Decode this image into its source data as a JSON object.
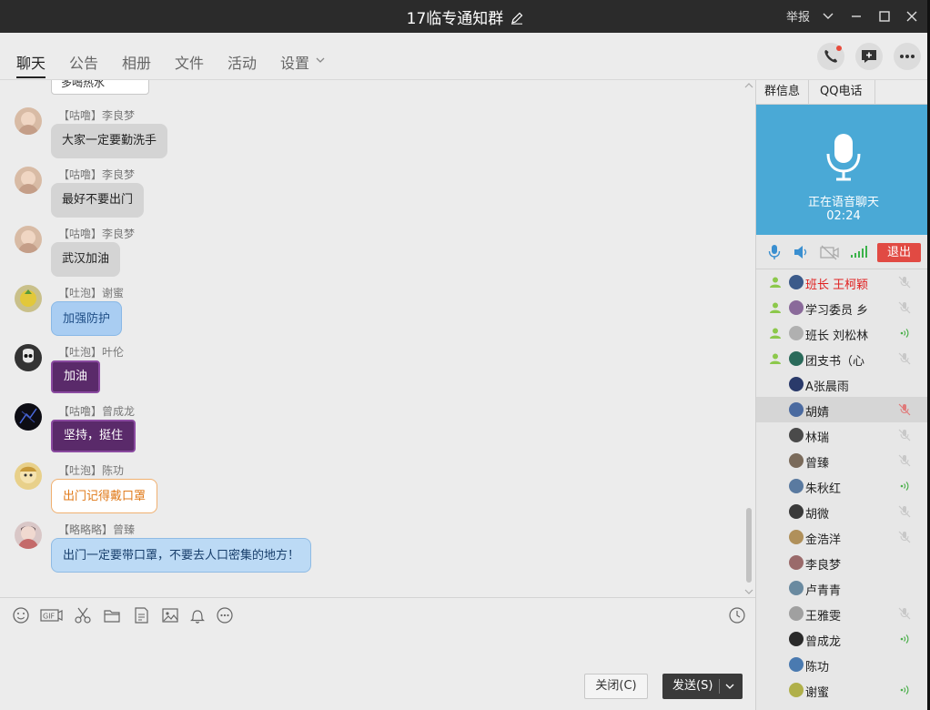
{
  "titlebar": {
    "title": "17临专通知群",
    "report": "举报"
  },
  "tabs": [
    {
      "label": "聊天"
    },
    {
      "label": "公告"
    },
    {
      "label": "相册"
    },
    {
      "label": "文件"
    },
    {
      "label": "活动"
    },
    {
      "label": "设置"
    }
  ],
  "messages": [
    {
      "header": "【咕噜】李良梦",
      "text": "大家一定要勤洗手"
    },
    {
      "header": "【咕噜】李良梦",
      "text": "最好不要出门"
    },
    {
      "header": "【咕噜】李良梦",
      "text": "武汉加油"
    },
    {
      "header": "【吐泡】谢蜜",
      "text": "加强防护"
    },
    {
      "header": "【吐泡】叶伦",
      "text": "加油"
    },
    {
      "header": "【咕噜】曾成龙",
      "text": "坚持，挺住"
    },
    {
      "header": "【吐泡】陈功",
      "text": "出门记得戴口罩"
    },
    {
      "header": "【略略略】曾臻",
      "text": "出门一定要带口罩，不要去人口密集的地方！"
    }
  ],
  "partial_top_message": "多喝热水",
  "input": {
    "close_label": "关闭(C)",
    "send_label": "发送(S)"
  },
  "side": {
    "tabs": [
      {
        "label": "群信息"
      },
      {
        "label": "QQ电话"
      }
    ],
    "voice_status": "正在语音聊天",
    "voice_time": "02:24",
    "quit_label": "退出",
    "members": [
      {
        "name": "班长 王柯颖",
        "admin": true,
        "red": true,
        "mic": "muted"
      },
      {
        "name": "学习委员 乡",
        "admin": true,
        "red": false,
        "mic": "muted"
      },
      {
        "name": "班长 刘松林",
        "admin": true,
        "red": false,
        "mic": "speaking"
      },
      {
        "name": "团支书（心",
        "admin": true,
        "red": false,
        "mic": "muted"
      },
      {
        "name": "A张晨雨",
        "admin": false,
        "red": false,
        "mic": "none"
      },
      {
        "name": "胡婧",
        "admin": false,
        "red": false,
        "mic": "muted-red",
        "selected": true
      },
      {
        "name": "林瑞",
        "admin": false,
        "red": false,
        "mic": "muted"
      },
      {
        "name": "曾臻",
        "admin": false,
        "red": false,
        "mic": "muted"
      },
      {
        "name": "朱秋红",
        "admin": false,
        "red": false,
        "mic": "speaking"
      },
      {
        "name": "胡微",
        "admin": false,
        "red": false,
        "mic": "muted"
      },
      {
        "name": "金浩洋",
        "admin": false,
        "red": false,
        "mic": "muted"
      },
      {
        "name": "李良梦",
        "admin": false,
        "red": false,
        "mic": "none"
      },
      {
        "name": "卢青青",
        "admin": false,
        "red": false,
        "mic": "none"
      },
      {
        "name": "王雅雯",
        "admin": false,
        "red": false,
        "mic": "muted"
      },
      {
        "name": "曾成龙",
        "admin": false,
        "red": false,
        "mic": "speaking"
      },
      {
        "name": "陈功",
        "admin": false,
        "red": false,
        "mic": "none"
      },
      {
        "name": "谢蜜",
        "admin": false,
        "red": false,
        "mic": "speaking"
      }
    ]
  },
  "colors": {
    "titlebar": "#2b2b2b",
    "voice_panel": "#4aa9d6",
    "quit": "#e14a43",
    "admin_icon": "#8cc84b"
  }
}
